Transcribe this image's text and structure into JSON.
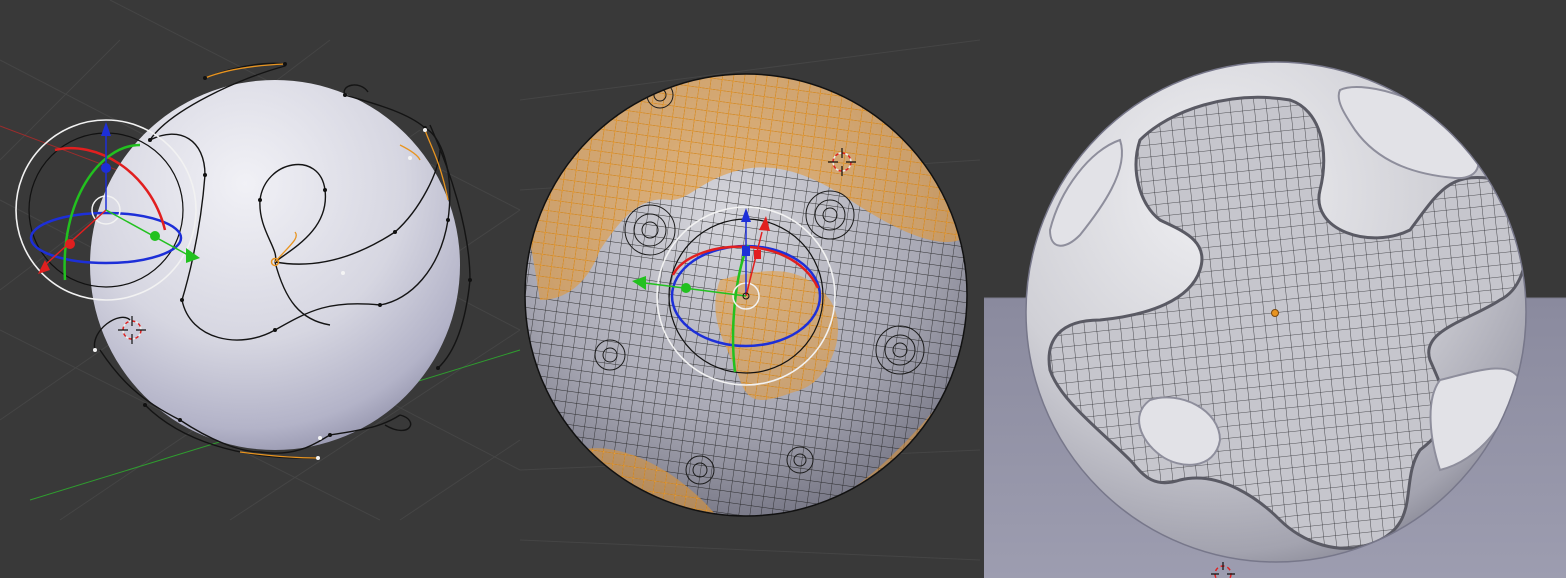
{
  "app": {
    "name": "",
    "panels": [
      {
        "id": "curve-guides",
        "mode": "object-mode-curves"
      },
      {
        "id": "mesh-edit",
        "mode": "edit-mode-selection"
      },
      {
        "id": "sculpt-render",
        "mode": "wireframe-overlay"
      }
    ]
  },
  "colors": {
    "viewport_bg": "#393939",
    "grid": "#464646",
    "axis_x": "#9c2c2c",
    "axis_y": "#2f9c2f",
    "selection": "#f2a43a",
    "gizmo_x": "#e11f1f",
    "gizmo_y": "#22c11f",
    "gizmo_z": "#1d2fd8",
    "floor": "#8f8fa3"
  },
  "icons": {
    "transform_gizmo": "transform-manipulator-icon",
    "cursor": "3d-cursor-icon",
    "origin": "object-origin-icon"
  }
}
